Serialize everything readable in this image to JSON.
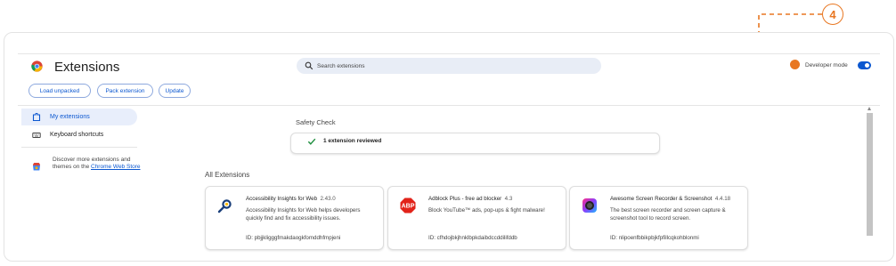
{
  "header": {
    "title": "Extensions",
    "search_placeholder": "Search extensions",
    "developer_mode_label": "Developer mode",
    "developer_mode_on": true
  },
  "toolbar": {
    "load_unpacked": "Load unpacked",
    "pack_extension": "Pack extension",
    "update": "Update"
  },
  "sidebar": {
    "items": [
      {
        "label": "My extensions",
        "icon": "puzzle-icon",
        "active": true
      },
      {
        "label": "Keyboard shortcuts",
        "icon": "keyboard-icon",
        "active": false
      }
    ],
    "discover_text": "Discover more extensions and themes on the ",
    "discover_link": "Chrome Web Store"
  },
  "safety_check": {
    "title": "Safety Check",
    "status": "1 extension reviewed"
  },
  "all_extensions": {
    "title": "All Extensions",
    "cards": [
      {
        "name": "Accessibility Insights for Web",
        "version": "2.43.0",
        "description": "Accessibility Insights for Web helps developers quickly find and fix accessibility issues.",
        "id": "ID: pbjjkligggfmakdaogkfomddhfmpjeni"
      },
      {
        "name": "Adblock Plus - free ad blocker",
        "version": "4.3",
        "description": "Block YouTube™ ads, pop-ups & fight malware!",
        "id": "ID: cfhdojbkjhnklbpkdaibdccddilifddb"
      },
      {
        "name": "Awesome Screen Recorder & Screenshot",
        "version": "4.4.18",
        "description": "The best screen recorder and screen capture & screenshot tool to record screen.",
        "id": "ID: nlipoenfbbikpbjkfpfillcqkohblonmi"
      }
    ]
  },
  "annotation": {
    "step_number": "4",
    "color": "#e87722"
  },
  "colors": {
    "accent": "#0b57d0",
    "annotation": "#e87722"
  }
}
